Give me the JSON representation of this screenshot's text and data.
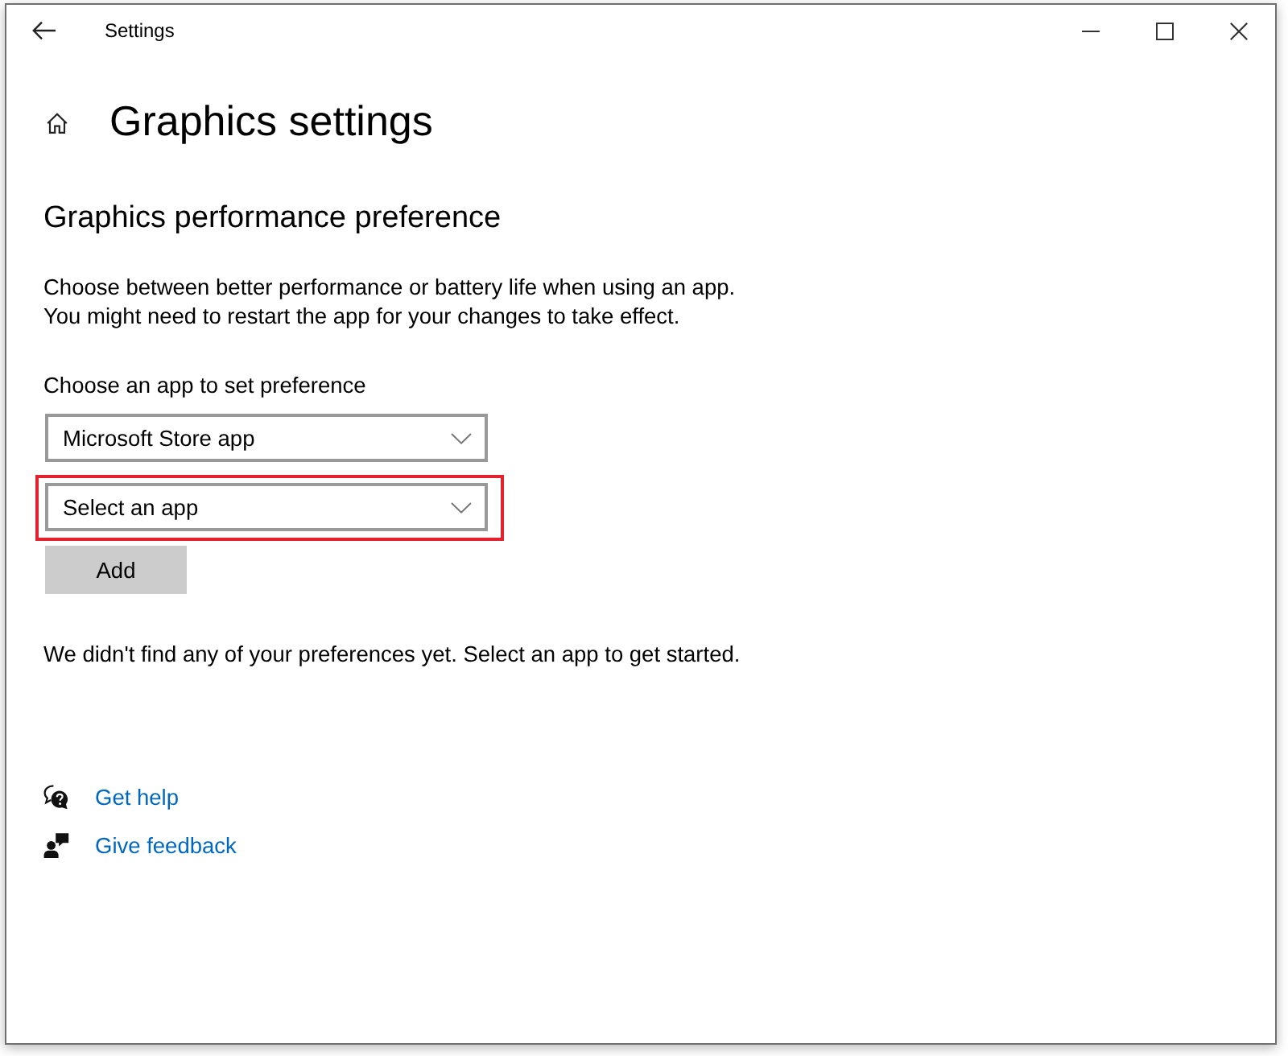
{
  "window": {
    "title": "Settings"
  },
  "header": {
    "title": "Graphics settings"
  },
  "section": {
    "heading": "Graphics performance preference",
    "description": [
      "Choose between better performance or battery life when using an app.",
      "You might need to restart the app for your changes to take effect."
    ]
  },
  "preference": {
    "label": "Choose an app to set preference",
    "dropdowns": [
      {
        "value": "Microsoft Store app",
        "highlighted": false
      },
      {
        "value": "Select an app",
        "highlighted": true
      }
    ],
    "add_button": "Add"
  },
  "empty_message": "We didn't find any of your preferences yet. Select an app to get started.",
  "links": [
    {
      "kind": "help",
      "label": "Get help"
    },
    {
      "kind": "feedback",
      "label": "Give feedback"
    }
  ]
}
